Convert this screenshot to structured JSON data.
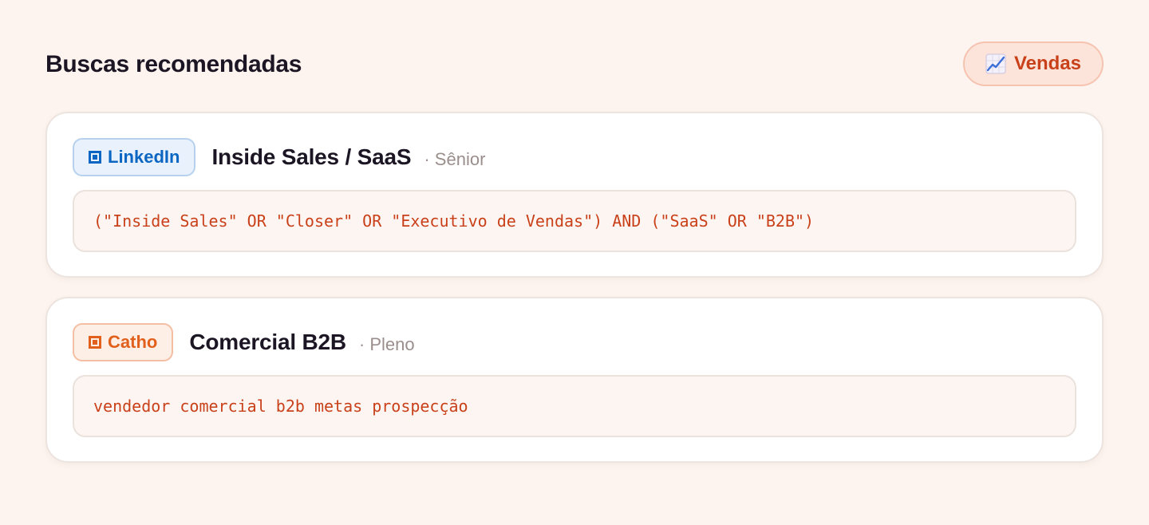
{
  "header": {
    "title": "Buscas recomendadas",
    "category": {
      "icon": "chart-increasing-icon",
      "label": "Vendas"
    }
  },
  "searches": [
    {
      "platform": {
        "icon": "square-icon",
        "label": "LinkedIn",
        "color": "#0a66c2"
      },
      "title": "Inside Sales / SaaS",
      "level": "· Sênior",
      "query": "(\"Inside Sales\" OR \"Closer\" OR \"Executivo de Vendas\") AND (\"SaaS\" OR \"B2B\")"
    },
    {
      "platform": {
        "icon": "square-icon",
        "label": "Catho",
        "color": "#e1601c"
      },
      "title": "Comercial B2B",
      "level": "· Pleno",
      "query": "vendedor comercial b2b metas prospecção"
    }
  ],
  "colors": {
    "background": "#fdf4ef",
    "accent": "#c9411a",
    "query_text": "#c9411a"
  }
}
